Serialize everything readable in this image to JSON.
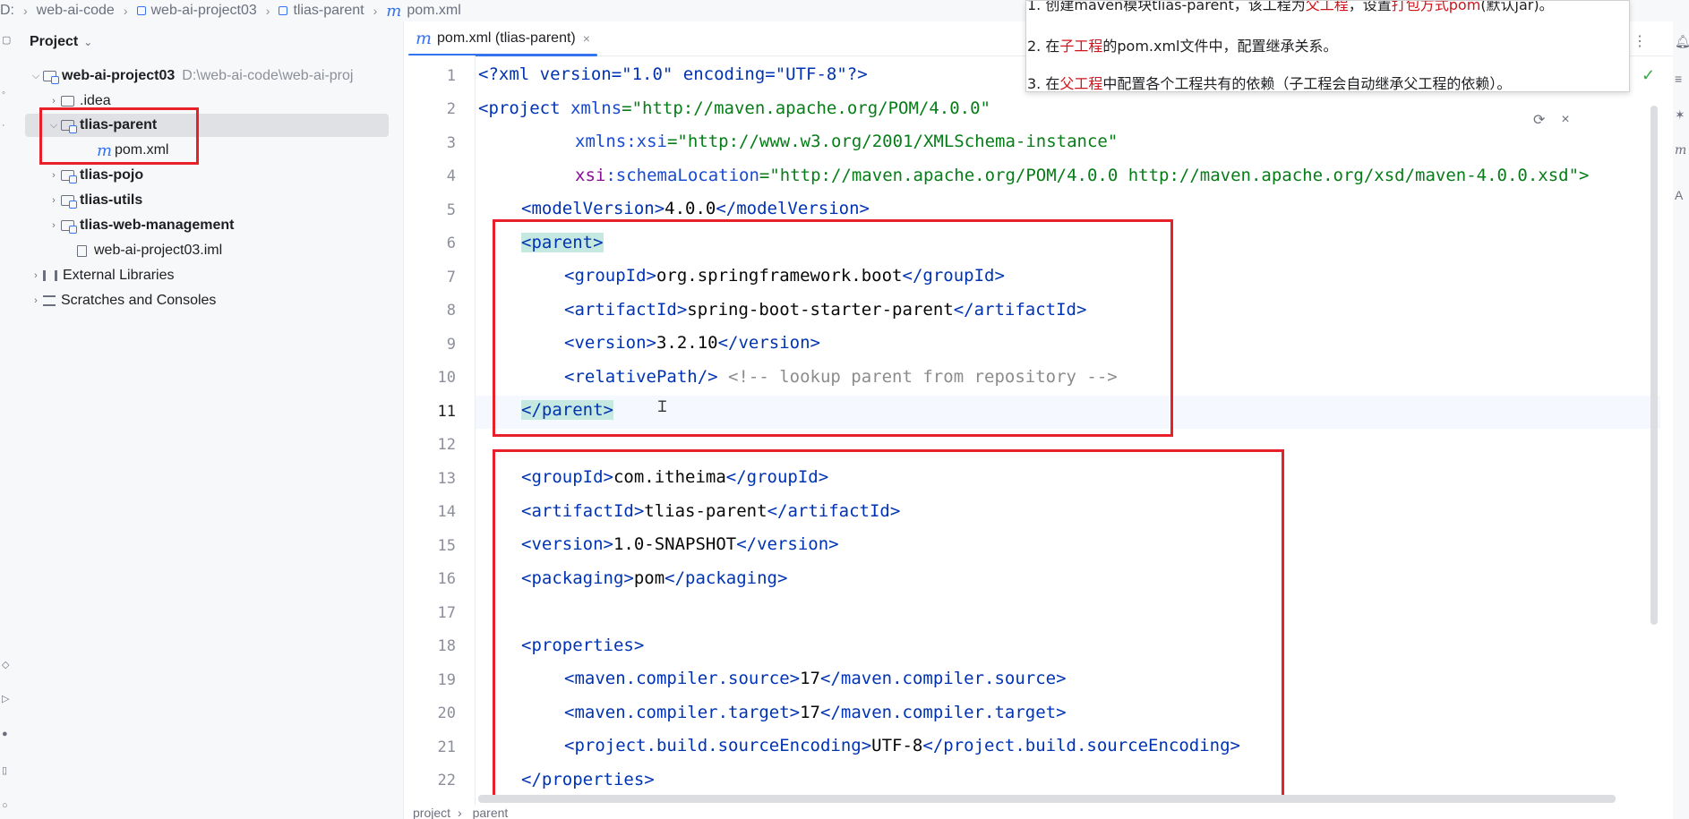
{
  "breadcrumb": {
    "items": [
      "D:",
      "web-ai-code",
      "web-ai-project03",
      "tlias-parent",
      "pom.xml"
    ]
  },
  "project_panel": {
    "title": "Project",
    "tree": [
      {
        "label": "web-ai-project03",
        "path": "D:\\web-ai-code\\web-ai-proj"
      },
      {
        "label": ".idea"
      },
      {
        "label": "tlias-parent"
      },
      {
        "label": "pom.xml"
      },
      {
        "label": "tlias-pojo"
      },
      {
        "label": "tlias-utils"
      },
      {
        "label": "tlias-web-management"
      },
      {
        "label": "web-ai-project03.iml"
      },
      {
        "label": "External Libraries"
      },
      {
        "label": "Scratches and Consoles"
      }
    ]
  },
  "editor": {
    "tab_label": "pom.xml (tlias-parent)",
    "line_numbers": [
      "1",
      "2",
      "3",
      "4",
      "5",
      "6",
      "7",
      "8",
      "9",
      "10",
      "11",
      "12",
      "13",
      "14",
      "15",
      "16",
      "17",
      "18",
      "19",
      "20",
      "21",
      "22"
    ],
    "code": {
      "l1_decl": "<?xml version=\"1.0\" encoding=\"UTF-8\"?>",
      "l2_tag": "<project ",
      "l2_attr": "xmlns",
      "l2_val": "=\"http://maven.apache.org/POM/4.0.0\"",
      "l3_ns": "xmlns",
      "l3_attr": ":xsi",
      "l3_val": "=\"http://www.w3.org/2001/XMLSchema-instance\"",
      "l4_ns": "xsi",
      "l4_attr": ":schemaLocation",
      "l4_val": "=\"http://maven.apache.org/POM/4.0.0 http://maven.apache.org/xsd/maven-4.0.0.xsd\">",
      "l5_open": "<modelVersion>",
      "l5_text": "4.0.0",
      "l5_close": "</modelVersion>",
      "l6_tag": "<parent>",
      "l7_open": "<groupId>",
      "l7_text": "org.springframework.boot",
      "l7_close": "</groupId>",
      "l8_open": "<artifactId>",
      "l8_text": "spring-boot-starter-parent",
      "l8_close": "</artifactId>",
      "l9_open": "<version>",
      "l9_text": "3.2.10",
      "l9_close": "</version>",
      "l10_tag": "<relativePath/>",
      "l10_comment": " <!-- lookup parent from repository -->",
      "l11_tag": "</parent>",
      "l13_open": "<groupId>",
      "l13_text": "com.itheima",
      "l13_close": "</groupId>",
      "l14_open": "<artifactId>",
      "l14_text": "tlias-parent",
      "l14_close": "</artifactId>",
      "l15_open": "<version>",
      "l15_text": "1.0-SNAPSHOT",
      "l15_close": "</version>",
      "l16_open": "<packaging>",
      "l16_text": "pom",
      "l16_close": "</packaging>",
      "l18_tag": "<properties>",
      "l19_open": "<maven.compiler.source>",
      "l19_text": "17",
      "l19_close": "</maven.compiler.source>",
      "l20_open": "<maven.compiler.target>",
      "l20_text": "17",
      "l20_close": "</maven.compiler.target>",
      "l21_open": "<project.build.sourceEncoding>",
      "l21_text": "UTF-8",
      "l21_close": "</project.build.sourceEncoding>",
      "l22_tag": "</properties>"
    }
  },
  "popup": {
    "line1_a": "1. 创建maven模块tlias-parent，该工程为",
    "line1_red1": "父工程",
    "line1_b": "，设置",
    "line1_red2": "打包方式pom",
    "line1_c": "(默认jar)。",
    "line2_a": "2. 在",
    "line2_red": "子工程",
    "line2_b": "的pom.xml文件中，配置继承关系。",
    "line3_a": "3. 在",
    "line3_red": "父工程",
    "line3_b": "中配置各个工程共有的依赖（子工程会自动继承父工程的依赖）。"
  },
  "status_bar": {
    "items": [
      "project",
      "parent"
    ]
  },
  "colors": {
    "accent": "#3574f0",
    "annotation_red": "#e8202a",
    "xml_tag": "#0033b3",
    "xml_string": "#067d17",
    "comment": "#8c8c8c"
  }
}
